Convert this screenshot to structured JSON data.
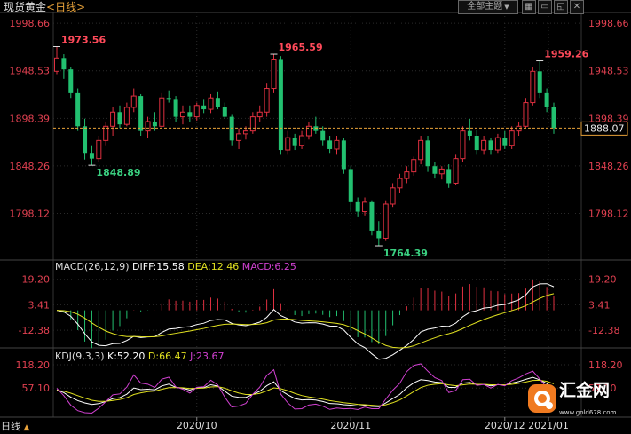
{
  "header": {
    "title": "现货黄金",
    "period": "<日线>",
    "theme_button": "全部主题",
    "theme_arrow": "▼",
    "icons": [
      "grid-icon",
      "minimize-icon",
      "maximize-icon",
      "close-icon"
    ]
  },
  "current_price": "1888.07",
  "price_axis": {
    "ticks": [
      "1998.66",
      "1948.53",
      "1898.39",
      "1848.26",
      "1798.12"
    ],
    "range": [
      1750,
      2010
    ]
  },
  "annotations": {
    "high1": "1973.56",
    "low1": "1848.89",
    "high2": "1965.59",
    "low2": "1764.39",
    "high3": "1959.26"
  },
  "macd": {
    "label": "MACD(26,12,9)",
    "diff": "DIFF:15.58",
    "dea": "DEA:12.46",
    "macd": "MACD:6.25",
    "ticks": [
      "19.20",
      "3.41",
      "-12.38"
    ]
  },
  "kdj": {
    "label": "KDJ(9,3,3)",
    "k": "K:52.20",
    "d": "D:66.47",
    "j": "J:23.67",
    "ticks": [
      "118.20",
      "57.10"
    ]
  },
  "x_axis": {
    "ticks": [
      "2020/10",
      "2020/11",
      "2020/12",
      "2021/01"
    ]
  },
  "bottom_bar": {
    "label": "日线",
    "arrow": "▲"
  },
  "logo": {
    "name": "汇金网",
    "url": "www.gold678.com"
  },
  "colors": {
    "up": "#e03040",
    "down": "#22c070",
    "diff": "#ffffff",
    "dea": "#e0e020",
    "macd": "#d040d0",
    "grid": "#2a2a2a",
    "accent": "#e8a23a"
  },
  "chart_data": {
    "type": "candlestick",
    "ohlc": [
      [
        1948,
        1974,
        1945,
        1962
      ],
      [
        1962,
        1966,
        1940,
        1950
      ],
      [
        1950,
        1952,
        1920,
        1925
      ],
      [
        1925,
        1930,
        1885,
        1890
      ],
      [
        1890,
        1898,
        1855,
        1862
      ],
      [
        1862,
        1870,
        1849,
        1856
      ],
      [
        1856,
        1880,
        1852,
        1875
      ],
      [
        1875,
        1895,
        1870,
        1890
      ],
      [
        1890,
        1910,
        1880,
        1905
      ],
      [
        1905,
        1912,
        1888,
        1892
      ],
      [
        1892,
        1915,
        1890,
        1910
      ],
      [
        1910,
        1930,
        1905,
        1922
      ],
      [
        1922,
        1924,
        1880,
        1885
      ],
      [
        1885,
        1900,
        1878,
        1895
      ],
      [
        1895,
        1905,
        1885,
        1890
      ],
      [
        1890,
        1925,
        1888,
        1920
      ],
      [
        1920,
        1928,
        1915,
        1918
      ],
      [
        1918,
        1922,
        1895,
        1900
      ],
      [
        1900,
        1912,
        1892,
        1905
      ],
      [
        1905,
        1912,
        1895,
        1900
      ],
      [
        1900,
        1915,
        1896,
        1912
      ],
      [
        1912,
        1918,
        1904,
        1908
      ],
      [
        1908,
        1924,
        1904,
        1920
      ],
      [
        1920,
        1926,
        1908,
        1910
      ],
      [
        1910,
        1915,
        1898,
        1900
      ],
      [
        1900,
        1902,
        1870,
        1875
      ],
      [
        1875,
        1888,
        1866,
        1882
      ],
      [
        1882,
        1890,
        1876,
        1885
      ],
      [
        1885,
        1905,
        1882,
        1900
      ],
      [
        1900,
        1912,
        1895,
        1905
      ],
      [
        1905,
        1935,
        1900,
        1930
      ],
      [
        1930,
        1966,
        1925,
        1960
      ],
      [
        1960,
        1964,
        1860,
        1865
      ],
      [
        1865,
        1885,
        1860,
        1878
      ],
      [
        1878,
        1882,
        1865,
        1870
      ],
      [
        1870,
        1885,
        1866,
        1880
      ],
      [
        1880,
        1895,
        1876,
        1890
      ],
      [
        1890,
        1900,
        1882,
        1885
      ],
      [
        1885,
        1890,
        1870,
        1875
      ],
      [
        1875,
        1880,
        1862,
        1866
      ],
      [
        1866,
        1880,
        1860,
        1875
      ],
      [
        1875,
        1878,
        1840,
        1845
      ],
      [
        1845,
        1848,
        1800,
        1810
      ],
      [
        1810,
        1815,
        1795,
        1800
      ],
      [
        1800,
        1815,
        1796,
        1810
      ],
      [
        1810,
        1812,
        1775,
        1780
      ],
      [
        1780,
        1790,
        1764,
        1772
      ],
      [
        1772,
        1812,
        1770,
        1808
      ],
      [
        1808,
        1830,
        1805,
        1825
      ],
      [
        1825,
        1840,
        1820,
        1835
      ],
      [
        1835,
        1848,
        1830,
        1842
      ],
      [
        1842,
        1858,
        1838,
        1855
      ],
      [
        1855,
        1880,
        1850,
        1875
      ],
      [
        1875,
        1880,
        1842,
        1848
      ],
      [
        1848,
        1852,
        1835,
        1840
      ],
      [
        1840,
        1848,
        1834,
        1845
      ],
      [
        1845,
        1850,
        1825,
        1830
      ],
      [
        1830,
        1860,
        1828,
        1856
      ],
      [
        1856,
        1890,
        1852,
        1885
      ],
      [
        1885,
        1898,
        1875,
        1880
      ],
      [
        1880,
        1886,
        1860,
        1865
      ],
      [
        1865,
        1880,
        1860,
        1875
      ],
      [
        1875,
        1878,
        1860,
        1865
      ],
      [
        1865,
        1882,
        1862,
        1878
      ],
      [
        1878,
        1885,
        1866,
        1870
      ],
      [
        1870,
        1890,
        1866,
        1885
      ],
      [
        1885,
        1895,
        1880,
        1890
      ],
      [
        1890,
        1920,
        1888,
        1915
      ],
      [
        1915,
        1952,
        1912,
        1948
      ],
      [
        1948,
        1959,
        1920,
        1925
      ],
      [
        1925,
        1930,
        1905,
        1910
      ],
      [
        1910,
        1915,
        1882,
        1888
      ]
    ]
  }
}
